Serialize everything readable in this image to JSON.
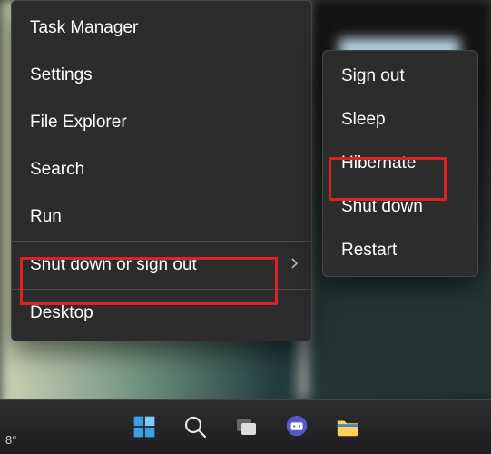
{
  "temperature_widget": {
    "text": "8°"
  },
  "context_menu": {
    "items": [
      {
        "label": "Task Manager"
      },
      {
        "label": "Settings"
      },
      {
        "label": "File Explorer"
      },
      {
        "label": "Search"
      },
      {
        "label": "Run"
      }
    ],
    "shutdown_item": {
      "label": "Shut down or sign out",
      "has_submenu": true
    },
    "desktop_item": {
      "label": "Desktop"
    }
  },
  "power_submenu": {
    "items": [
      {
        "label": "Sign out"
      },
      {
        "label": "Sleep"
      },
      {
        "label": "Hibernate"
      },
      {
        "label": "Shut down"
      },
      {
        "label": "Restart"
      }
    ]
  },
  "highlights": {
    "primary": "Shut down or sign out",
    "secondary": "Hibernate"
  },
  "colors": {
    "menu_bg": "#2c2c2c",
    "highlight": "#d22222",
    "text": "#ffffff"
  }
}
